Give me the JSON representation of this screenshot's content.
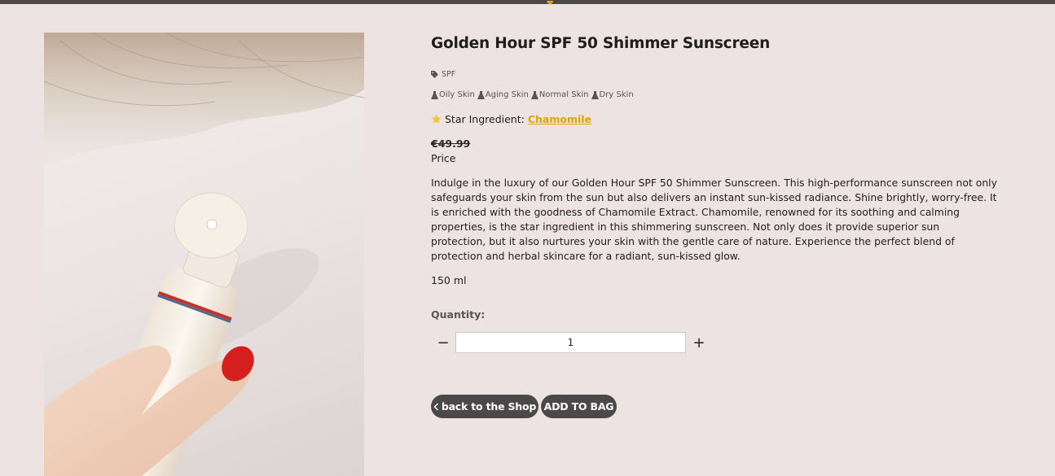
{
  "product": {
    "title": "Golden Hour SPF 50 Shimmer Sunscreen",
    "category": "SPF",
    "skin_types": [
      "Oily Skin",
      "Aging Skin",
      "Normal Skin",
      "Dry Skin"
    ],
    "star_ingredient_label": "Star Ingredient:",
    "star_ingredient": "Chamomile",
    "old_price": "€49.99",
    "price_label": "Price",
    "description": "Indulge in the luxury of our Golden Hour SPF 50 Shimmer Sunscreen. This high-performance sunscreen not only safeguards your skin from the sun but also delivers an instant sun-kissed radiance. Shine brightly, worry-free. It is enriched with the goodness of Chamomile Extract. Chamomile, renowned for its soothing and calming properties, is the star ingredient in this shimmering sunscreen. Not only does it provide superior sun protection, but it also nurtures your skin with the gentle care of nature. Experience the perfect blend of protection and herbal skincare for a radiant, sun-kissed glow.",
    "volume": "150 ml"
  },
  "quantity": {
    "label": "Quantity:",
    "value": "1",
    "minus_symbol": "−",
    "plus_symbol": "+"
  },
  "actions": {
    "back_label": "back to the Shop",
    "add_label": "ADD TO BAG"
  },
  "icons": {
    "category": "tag-icon",
    "skin_type": "flask-icon",
    "ingredient": "star-icon",
    "back": "chevron-left-icon"
  },
  "colors": {
    "accent": "#e0a500",
    "button": "#4a4848",
    "background": "#ece3e2",
    "top_bar": "#4b4847"
  }
}
